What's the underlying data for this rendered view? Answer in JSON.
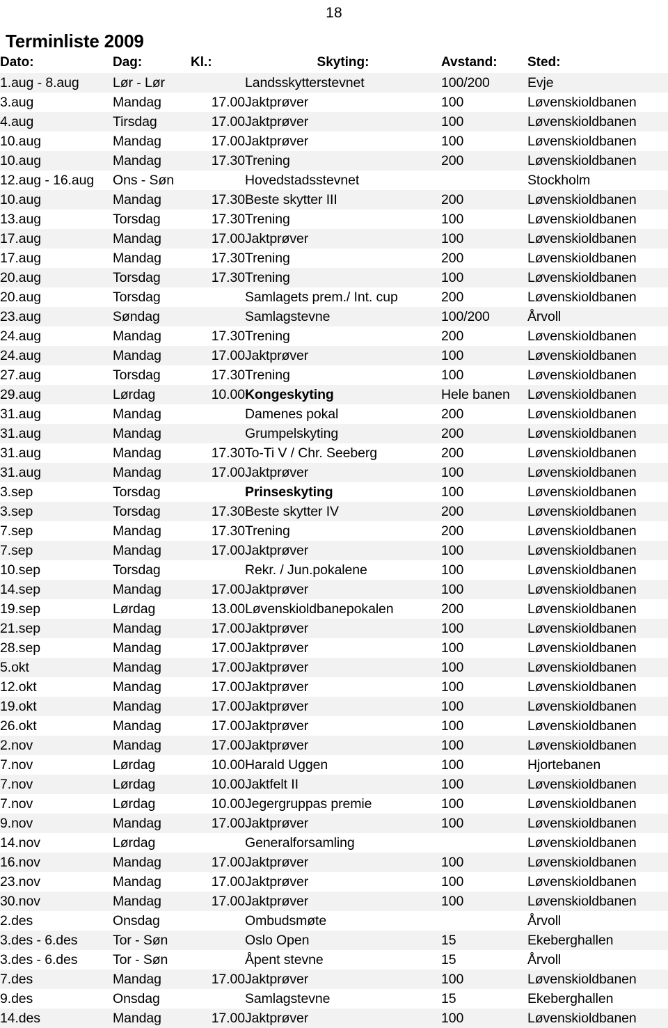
{
  "page": {
    "number": "18",
    "title": "Terminliste 2009"
  },
  "table": {
    "headers": {
      "date": "Dato:",
      "day": "Dag:",
      "time": "Kl.:",
      "event": "Skyting:",
      "distance": "Avstand:",
      "place": "Sted:"
    },
    "rows": [
      {
        "date": "1.aug - 8.aug",
        "day": "Lør - Lør",
        "time": "",
        "event": "Landsskytterstevnet",
        "bold": false,
        "distance": "100/200",
        "place": "Evje"
      },
      {
        "date": "3.aug",
        "day": "Mandag",
        "time": "17.00",
        "event": "Jaktprøver",
        "bold": false,
        "distance": "100",
        "place": "Løvenskioldbanen"
      },
      {
        "date": "4.aug",
        "day": "Tirsdag",
        "time": "17.00",
        "event": "Jaktprøver",
        "bold": false,
        "distance": "100",
        "place": "Løvenskioldbanen"
      },
      {
        "date": "10.aug",
        "day": "Mandag",
        "time": "17.00",
        "event": "Jaktprøver",
        "bold": false,
        "distance": "100",
        "place": "Løvenskioldbanen"
      },
      {
        "date": "10.aug",
        "day": "Mandag",
        "time": "17.30",
        "event": "Trening",
        "bold": false,
        "distance": "200",
        "place": "Løvenskioldbanen"
      },
      {
        "date": "12.aug - 16.aug",
        "day": "Ons - Søn",
        "time": "",
        "event": "Hovedstadsstevnet",
        "bold": false,
        "distance": "",
        "place": "Stockholm"
      },
      {
        "date": "10.aug",
        "day": "Mandag",
        "time": "17.30",
        "event": "Beste skytter III",
        "bold": false,
        "distance": "200",
        "place": "Løvenskioldbanen"
      },
      {
        "date": "13.aug",
        "day": "Torsdag",
        "time": "17.30",
        "event": "Trening",
        "bold": false,
        "distance": "100",
        "place": "Løvenskioldbanen"
      },
      {
        "date": "17.aug",
        "day": "Mandag",
        "time": "17.00",
        "event": "Jaktprøver",
        "bold": false,
        "distance": "100",
        "place": "Løvenskioldbanen"
      },
      {
        "date": "17.aug",
        "day": "Mandag",
        "time": "17.30",
        "event": "Trening",
        "bold": false,
        "distance": "200",
        "place": "Løvenskioldbanen"
      },
      {
        "date": "20.aug",
        "day": "Torsdag",
        "time": "17.30",
        "event": "Trening",
        "bold": false,
        "distance": "100",
        "place": "Løvenskioldbanen"
      },
      {
        "date": "20.aug",
        "day": "Torsdag",
        "time": "",
        "event": "Samlagets prem./ Int. cup",
        "bold": false,
        "distance": "200",
        "place": "Løvenskioldbanen"
      },
      {
        "date": "23.aug",
        "day": "Søndag",
        "time": "",
        "event": "Samlagstevne",
        "bold": false,
        "distance": "100/200",
        "place": "Årvoll"
      },
      {
        "date": "24.aug",
        "day": "Mandag",
        "time": "17.30",
        "event": "Trening",
        "bold": false,
        "distance": "200",
        "place": "Løvenskioldbanen"
      },
      {
        "date": "24.aug",
        "day": "Mandag",
        "time": "17.00",
        "event": "Jaktprøver",
        "bold": false,
        "distance": "100",
        "place": "Løvenskioldbanen"
      },
      {
        "date": "27.aug",
        "day": "Torsdag",
        "time": "17.30",
        "event": "Trening",
        "bold": false,
        "distance": "100",
        "place": "Løvenskioldbanen"
      },
      {
        "date": "29.aug",
        "day": "Lørdag",
        "time": "10.00",
        "event": "Kongeskyting",
        "bold": true,
        "distance": "Hele banen",
        "place": "Løvenskioldbanen"
      },
      {
        "date": "31.aug",
        "day": "Mandag",
        "time": "",
        "event": "Damenes pokal",
        "bold": false,
        "distance": "200",
        "place": "Løvenskioldbanen"
      },
      {
        "date": "31.aug",
        "day": "Mandag",
        "time": "",
        "event": "Grumpelskyting",
        "bold": false,
        "distance": "200",
        "place": "Løvenskioldbanen"
      },
      {
        "date": "31.aug",
        "day": "Mandag",
        "time": "17.30",
        "event": "To-Ti V / Chr. Seeberg",
        "bold": false,
        "distance": "200",
        "place": "Løvenskioldbanen"
      },
      {
        "date": "31.aug",
        "day": "Mandag",
        "time": "17.00",
        "event": "Jaktprøver",
        "bold": false,
        "distance": "100",
        "place": "Løvenskioldbanen"
      },
      {
        "date": "3.sep",
        "day": "Torsdag",
        "time": "",
        "event": "Prinseskyting",
        "bold": true,
        "distance": "100",
        "place": "Løvenskioldbanen"
      },
      {
        "date": "3.sep",
        "day": "Torsdag",
        "time": "17.30",
        "event": "Beste skytter IV",
        "bold": false,
        "distance": "200",
        "place": "Løvenskioldbanen"
      },
      {
        "date": "7.sep",
        "day": "Mandag",
        "time": "17.30",
        "event": "Trening",
        "bold": false,
        "distance": "200",
        "place": "Løvenskioldbanen"
      },
      {
        "date": "7.sep",
        "day": "Mandag",
        "time": "17.00",
        "event": "Jaktprøver",
        "bold": false,
        "distance": "100",
        "place": "Løvenskioldbanen"
      },
      {
        "date": "10.sep",
        "day": "Torsdag",
        "time": "",
        "event": "Rekr. / Jun.pokalene",
        "bold": false,
        "distance": "100",
        "place": "Løvenskioldbanen"
      },
      {
        "date": "14.sep",
        "day": "Mandag",
        "time": "17.00",
        "event": "Jaktprøver",
        "bold": false,
        "distance": "100",
        "place": "Løvenskioldbanen"
      },
      {
        "date": "19.sep",
        "day": "Lørdag",
        "time": "13.00",
        "event": "Løvenskioldbanepokalen",
        "bold": false,
        "distance": "200",
        "place": "Løvenskioldbanen"
      },
      {
        "date": "21.sep",
        "day": "Mandag",
        "time": "17.00",
        "event": "Jaktprøver",
        "bold": false,
        "distance": "100",
        "place": "Løvenskioldbanen"
      },
      {
        "date": "28.sep",
        "day": "Mandag",
        "time": "17.00",
        "event": "Jaktprøver",
        "bold": false,
        "distance": "100",
        "place": "Løvenskioldbanen"
      },
      {
        "date": "5.okt",
        "day": "Mandag",
        "time": "17.00",
        "event": "Jaktprøver",
        "bold": false,
        "distance": "100",
        "place": "Løvenskioldbanen"
      },
      {
        "date": "12.okt",
        "day": "Mandag",
        "time": "17.00",
        "event": "Jaktprøver",
        "bold": false,
        "distance": "100",
        "place": "Løvenskioldbanen"
      },
      {
        "date": "19.okt",
        "day": "Mandag",
        "time": "17.00",
        "event": "Jaktprøver",
        "bold": false,
        "distance": "100",
        "place": "Løvenskioldbanen"
      },
      {
        "date": "26.okt",
        "day": "Mandag",
        "time": "17.00",
        "event": "Jaktprøver",
        "bold": false,
        "distance": "100",
        "place": "Løvenskioldbanen"
      },
      {
        "date": "2.nov",
        "day": "Mandag",
        "time": "17.00",
        "event": "Jaktprøver",
        "bold": false,
        "distance": "100",
        "place": "Løvenskioldbanen"
      },
      {
        "date": "7.nov",
        "day": "Lørdag",
        "time": "10.00",
        "event": "Harald Uggen",
        "bold": false,
        "distance": "100",
        "place": "Hjortebanen"
      },
      {
        "date": "7.nov",
        "day": "Lørdag",
        "time": "10.00",
        "event": "Jaktfelt II",
        "bold": false,
        "distance": "100",
        "place": "Løvenskioldbanen"
      },
      {
        "date": "7.nov",
        "day": "Lørdag",
        "time": "10.00",
        "event": "Jegergruppas premie",
        "bold": false,
        "distance": "100",
        "place": "Løvenskioldbanen"
      },
      {
        "date": "9.nov",
        "day": "Mandag",
        "time": "17.00",
        "event": "Jaktprøver",
        "bold": false,
        "distance": "100",
        "place": "Løvenskioldbanen"
      },
      {
        "date": "14.nov",
        "day": "Lørdag",
        "time": "",
        "event": "Generalforsamling",
        "bold": false,
        "distance": "",
        "place": "Løvenskioldbanen"
      },
      {
        "date": "16.nov",
        "day": "Mandag",
        "time": "17.00",
        "event": "Jaktprøver",
        "bold": false,
        "distance": "100",
        "place": "Løvenskioldbanen"
      },
      {
        "date": "23.nov",
        "day": "Mandag",
        "time": "17.00",
        "event": "Jaktprøver",
        "bold": false,
        "distance": "100",
        "place": "Løvenskioldbanen"
      },
      {
        "date": "30.nov",
        "day": "Mandag",
        "time": "17.00",
        "event": "Jaktprøver",
        "bold": false,
        "distance": "100",
        "place": "Løvenskioldbanen"
      },
      {
        "date": "2.des",
        "day": "Onsdag",
        "time": "",
        "event": "Ombudsmøte",
        "bold": false,
        "distance": "",
        "place": "Årvoll"
      },
      {
        "date": "3.des - 6.des",
        "day": "Tor - Søn",
        "time": "",
        "event": "Oslo Open",
        "bold": false,
        "distance": "15",
        "place": "Ekeberghallen"
      },
      {
        "date": "3.des - 6.des",
        "day": "Tor - Søn",
        "time": "",
        "event": "Åpent stevne",
        "bold": false,
        "distance": "15",
        "place": "Årvoll"
      },
      {
        "date": "7.des",
        "day": "Mandag",
        "time": "17.00",
        "event": "Jaktprøver",
        "bold": false,
        "distance": "100",
        "place": "Løvenskioldbanen"
      },
      {
        "date": "9.des",
        "day": "Onsdag",
        "time": "",
        "event": "Samlagstevne",
        "bold": false,
        "distance": "15",
        "place": "Ekeberghallen"
      },
      {
        "date": "14.des",
        "day": "Mandag",
        "time": "17.00",
        "event": "Jaktprøver",
        "bold": false,
        "distance": "100",
        "place": "Løvenskioldbanen"
      }
    ]
  }
}
